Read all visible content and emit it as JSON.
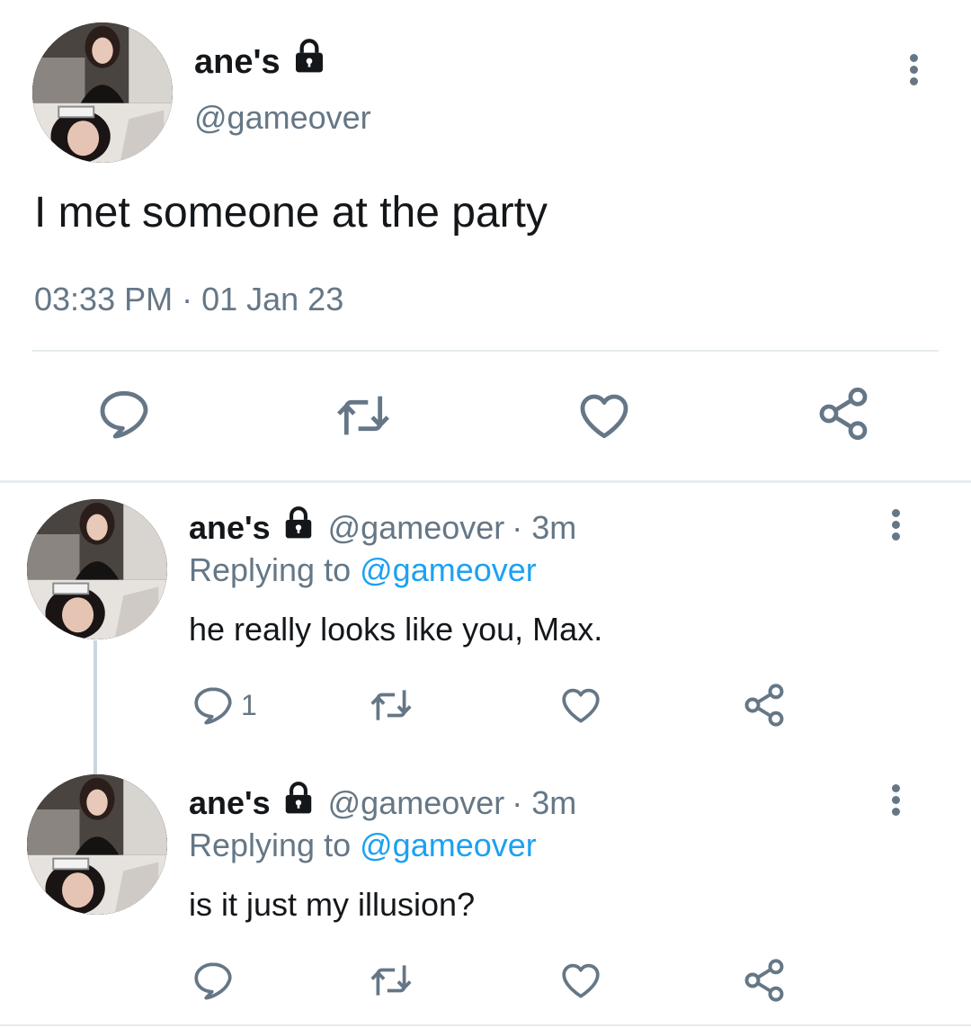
{
  "main_tweet": {
    "name": "ane's",
    "handle": "@gameover",
    "text": "I met someone at the party",
    "timestamp": "03:33 PM · 01 Jan 23",
    "icons": [
      "reply-icon",
      "retweet-icon",
      "like-icon",
      "share-icon",
      "lock-icon",
      "more-icon"
    ]
  },
  "replies": [
    {
      "name": "ane's",
      "handle": "@gameover",
      "time": "· 3m",
      "replying_prefix": "Replying to",
      "replying_to": "@gameover",
      "text": "he really looks like you, Max.",
      "reply_count": "1"
    },
    {
      "name": "ane's",
      "handle": "@gameover",
      "time": "· 3m",
      "replying_prefix": "Replying to",
      "replying_to": "@gameover",
      "text": "is it just my illusion?",
      "reply_count": ""
    }
  ],
  "colors": {
    "text": "#14171a",
    "secondary": "#657786",
    "link": "#1da1f2",
    "divider": "#e6ecf0"
  }
}
